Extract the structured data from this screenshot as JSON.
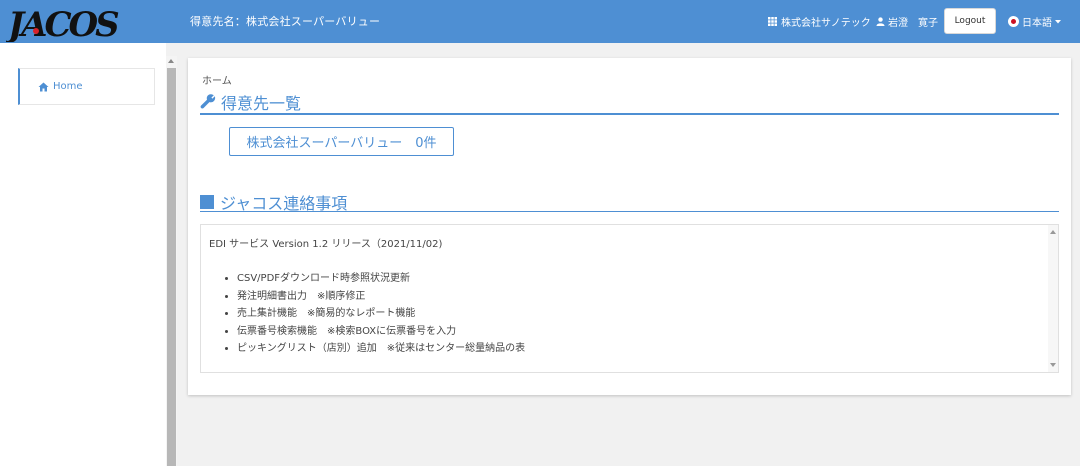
{
  "header": {
    "logo_text": "JACOS",
    "customer_label": "得意先名：株式会社スーパーバリュー",
    "company": "株式会社サノテック",
    "user": "岩澄　寛子",
    "logout": "Logout",
    "language": "日本語",
    "bg_color": "#4e8fd3"
  },
  "sidebar": {
    "items": [
      {
        "label": "Home",
        "icon": "home-icon"
      }
    ]
  },
  "main": {
    "breadcrumb": "ホーム",
    "title": "得意先一覧",
    "customer_button": "株式会社スーパーバリュー　0件",
    "notice_title": "ジャコス連絡事項",
    "notice": {
      "heading": "EDI サービス Version 1.2 リリース（2021/11/02)",
      "items": [
        "CSV/PDFダウンロード時参照状況更新",
        "発注明細書出力　※順序修正",
        "売上集計機能　※簡易的なレポート機能",
        "伝票番号検索機能　※検索BOXに伝票番号を入力",
        "ピッキングリスト（店別）追加　※従来はセンター総量納品の表"
      ]
    }
  }
}
